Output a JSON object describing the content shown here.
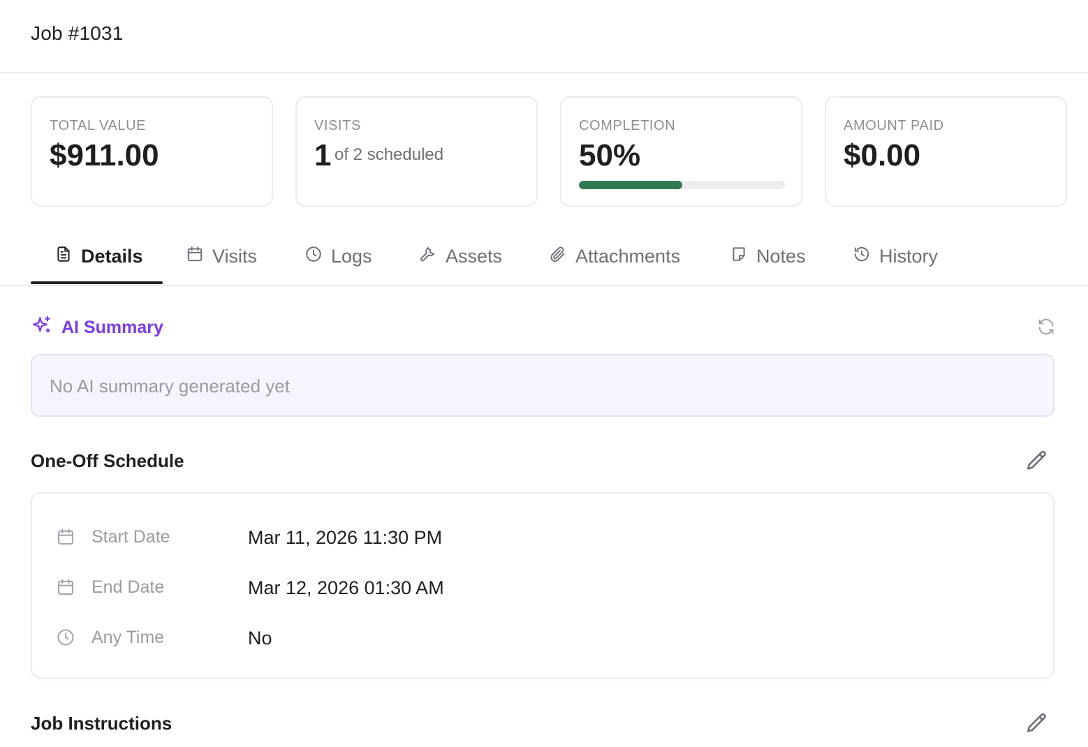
{
  "header": {
    "title": "Job #1031"
  },
  "stats": {
    "total_value": {
      "label": "TOTAL VALUE",
      "value": "$911.00"
    },
    "visits": {
      "label": "VISITS",
      "value": "1",
      "sub": "of 2 scheduled"
    },
    "completion": {
      "label": "COMPLETION",
      "value": "50%",
      "progress": 0.5
    },
    "amount_paid": {
      "label": "AMOUNT PAID",
      "value": "$0.00"
    }
  },
  "tabs": [
    {
      "label": "Details",
      "icon": "document-icon",
      "active": true
    },
    {
      "label": "Visits",
      "icon": "calendar-icon"
    },
    {
      "label": "Logs",
      "icon": "clock-icon"
    },
    {
      "label": "Assets",
      "icon": "wrench-icon"
    },
    {
      "label": "Attachments",
      "icon": "paperclip-icon"
    },
    {
      "label": "Notes",
      "icon": "note-icon"
    },
    {
      "label": "History",
      "icon": "history-icon"
    }
  ],
  "ai_summary": {
    "title": "AI Summary",
    "icon": "sparkles-icon",
    "empty_message": "No AI summary generated yet",
    "refresh_icon": "refresh-icon"
  },
  "schedule": {
    "title": "One-Off Schedule",
    "rows": [
      {
        "icon": "calendar-icon",
        "label": "Start Date",
        "value": "Mar 11, 2026 11:30 PM"
      },
      {
        "icon": "calendar-icon",
        "label": "End Date",
        "value": "Mar 12, 2026 01:30 AM"
      },
      {
        "icon": "clock-icon",
        "label": "Any Time",
        "value": "No"
      }
    ]
  },
  "instructions": {
    "title": "Job Instructions"
  },
  "colors": {
    "accent_purple": "#7c3aed",
    "progress_green": "#2f7a4e",
    "text_primary": "#1f1f23",
    "text_muted": "#9a9aa2"
  }
}
